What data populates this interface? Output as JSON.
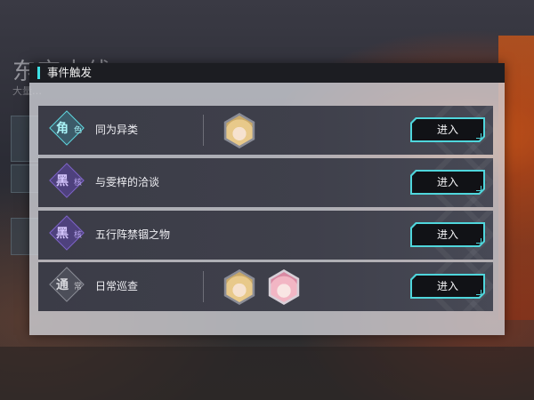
{
  "background": {
    "title": "东京支线",
    "subtitle": "大量…"
  },
  "dialog": {
    "title": "事件触发",
    "accent_color": "#3ee1e6",
    "events": [
      {
        "tag_big": "角",
        "tag_small": "色",
        "tag_style": "cyan",
        "title": "同为异类",
        "avatars": [
          "blonde-character"
        ],
        "enter_label": "进入"
      },
      {
        "tag_big": "黑",
        "tag_small": "核",
        "tag_style": "purple",
        "title": "与雯梓的洽谈",
        "avatars": [],
        "enter_label": "进入"
      },
      {
        "tag_big": "黑",
        "tag_small": "核",
        "tag_style": "purple",
        "title": "五行阵禁锢之物",
        "avatars": [],
        "enter_label": "进入"
      },
      {
        "tag_big": "通",
        "tag_small": "常",
        "tag_style": "grey",
        "title": "日常巡查",
        "avatars": [
          "blonde-character",
          "pink-hair-character"
        ],
        "enter_label": "进入"
      }
    ]
  }
}
